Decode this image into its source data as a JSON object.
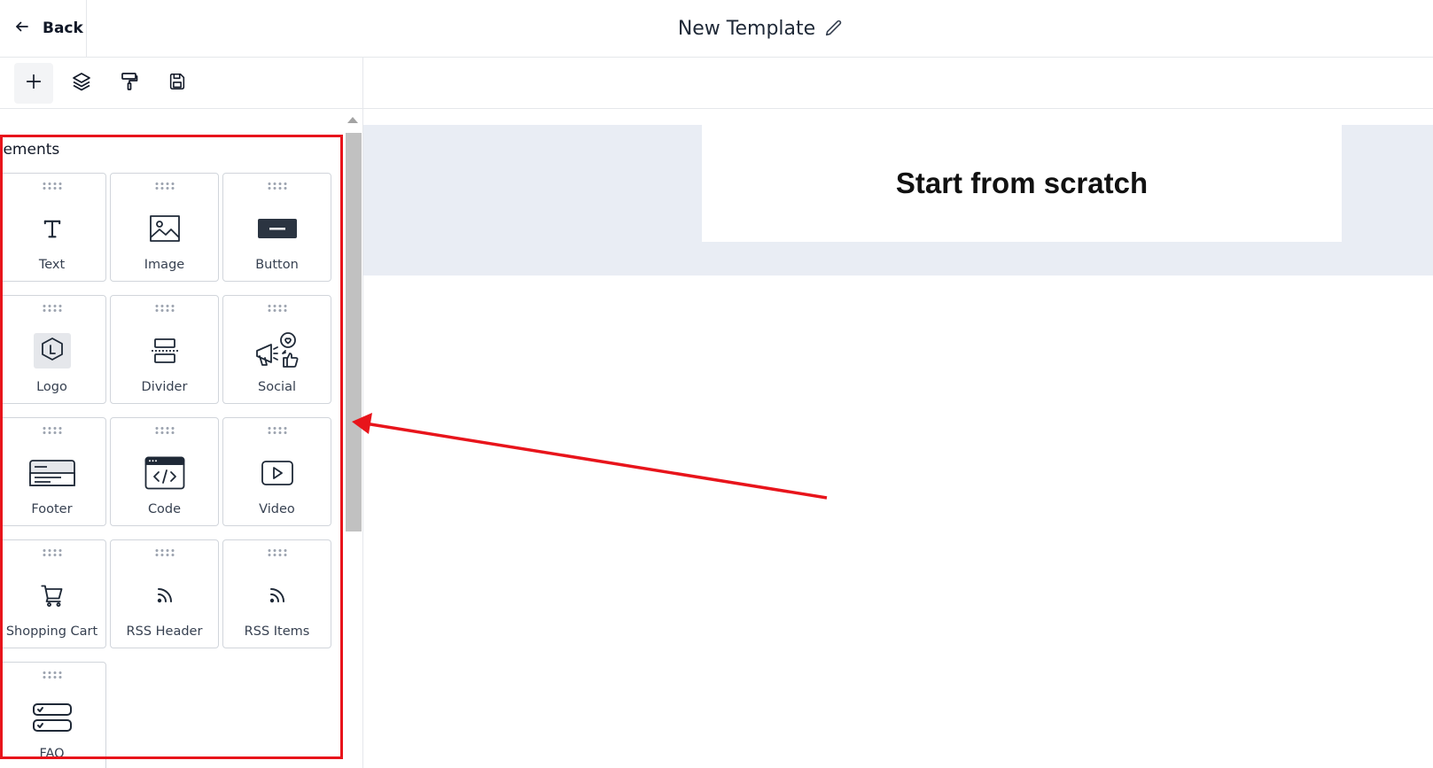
{
  "header": {
    "back_label": "Back",
    "title": "New Template"
  },
  "toolbar": {
    "tools": [
      "plus-icon",
      "layers-icon",
      "paint-roller-icon",
      "save-icon"
    ],
    "active": "plus-icon"
  },
  "sidebar": {
    "section_title": "Elements",
    "elements": [
      {
        "label": "Text",
        "icon": "text-icon"
      },
      {
        "label": "Image",
        "icon": "image-icon"
      },
      {
        "label": "Button",
        "icon": "button-icon"
      },
      {
        "label": "Logo",
        "icon": "logo-icon"
      },
      {
        "label": "Divider",
        "icon": "divider-icon"
      },
      {
        "label": "Social",
        "icon": "social-icon"
      },
      {
        "label": "Footer",
        "icon": "footer-icon"
      },
      {
        "label": "Code",
        "icon": "code-icon"
      },
      {
        "label": "Video",
        "icon": "video-icon"
      },
      {
        "label": "Shopping Cart",
        "icon": "shopping-cart-icon"
      },
      {
        "label": "RSS Header",
        "icon": "rss-icon"
      },
      {
        "label": "RSS Items",
        "icon": "rss-icon"
      },
      {
        "label": "FAQ",
        "icon": "faq-icon"
      }
    ]
  },
  "canvas": {
    "heading": "Start from scratch"
  },
  "annotation": {
    "color": "#e8141b"
  }
}
